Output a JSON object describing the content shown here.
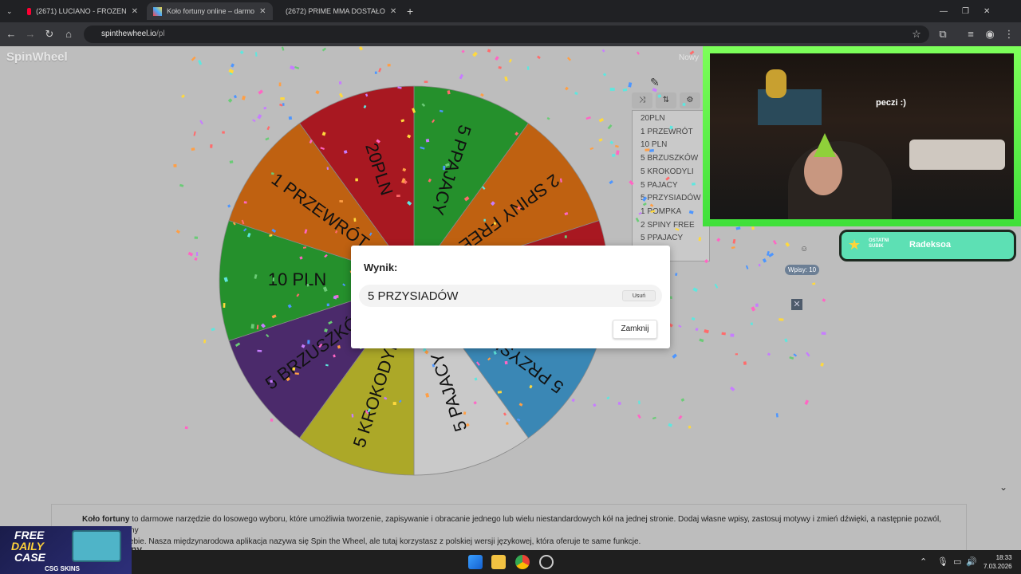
{
  "browser": {
    "tabs": [
      {
        "title": "(2671) LUCIANO - FROZEN",
        "active": false
      },
      {
        "title": "Koło fortuny online – darmo",
        "active": true
      },
      {
        "title": "(2672) PRIME MMA DOSTAŁO",
        "active": false
      }
    ],
    "url_domain": "spinthewheel.io",
    "url_path": "/pl"
  },
  "site": {
    "logo": "SpinWheel",
    "nowy_label": "Nowy"
  },
  "wheel": {
    "segments": [
      {
        "label": "5 PPAJACY",
        "color": "#25902c"
      },
      {
        "label": "2 SPINY FREE",
        "color": "#bf6111"
      },
      {
        "label": "1 POMPKA",
        "color": "#a81821"
      },
      {
        "label": "5 PRZYSIADÓW",
        "color": "#3a87b5"
      },
      {
        "label": "5 PAJACY",
        "color": "#c9c9c9"
      },
      {
        "label": "5 KROKODYLI",
        "color": "#aca828"
      },
      {
        "label": "5 BRZUSZKÓW",
        "color": "#4b2a6b"
      },
      {
        "label": "10 PLN",
        "color": "#25902c"
      },
      {
        "label": "1 PRZEWRÓT",
        "color": "#bf6111"
      },
      {
        "label": "20PLN",
        "color": "#a81821"
      }
    ]
  },
  "entries": {
    "items": [
      "20PLN",
      "1 PRZEWRÓT",
      "10 PLN",
      "5 BRZUSZKÓW",
      "5 KROKODYLI",
      "5 PAJACY",
      "5 PRZYSIADÓW",
      "1 POMPKA",
      "2 SPINY FREE",
      "5 PPAJACY"
    ],
    "count_label": "Wpisy: 10"
  },
  "dialog": {
    "title": "Wynik:",
    "result": "5 PRZYSIADÓW",
    "remove_label": "Usuń",
    "close_label": "Zamknij"
  },
  "stream": {
    "caption": "peczi :)",
    "sub_label_line1": "OSTATNI",
    "sub_label_line2": "SUBIK",
    "sub_name": "Radeksoa"
  },
  "description": {
    "bold": "Koło fortuny",
    "text": " to darmowe narzędzie do losowego wyboru, które umożliwia tworzenie, zapisywanie i obracanie jednego lub wielu niestandardowych kół na jednej stronie. Dodaj własne wpisy, zastosuj motywy i zmień dźwięki, a następnie pozwól, aby koło fortuny",
    "text2": "wowało za Ciebie. Nasza międzynarodowa aplikacja nazywa się Spin the Wheel, ale tutaj korzystasz z polskiej wersji językowej, która oferuje te same funkcje.",
    "heading_fragment": "i Koło fortuny"
  },
  "promo": {
    "line1": "FREE",
    "line2": "DAILY",
    "line3": "CASE",
    "brand": "CSG SKINS"
  },
  "taskbar": {
    "time": "18:33",
    "date": "7.03.2026"
  }
}
